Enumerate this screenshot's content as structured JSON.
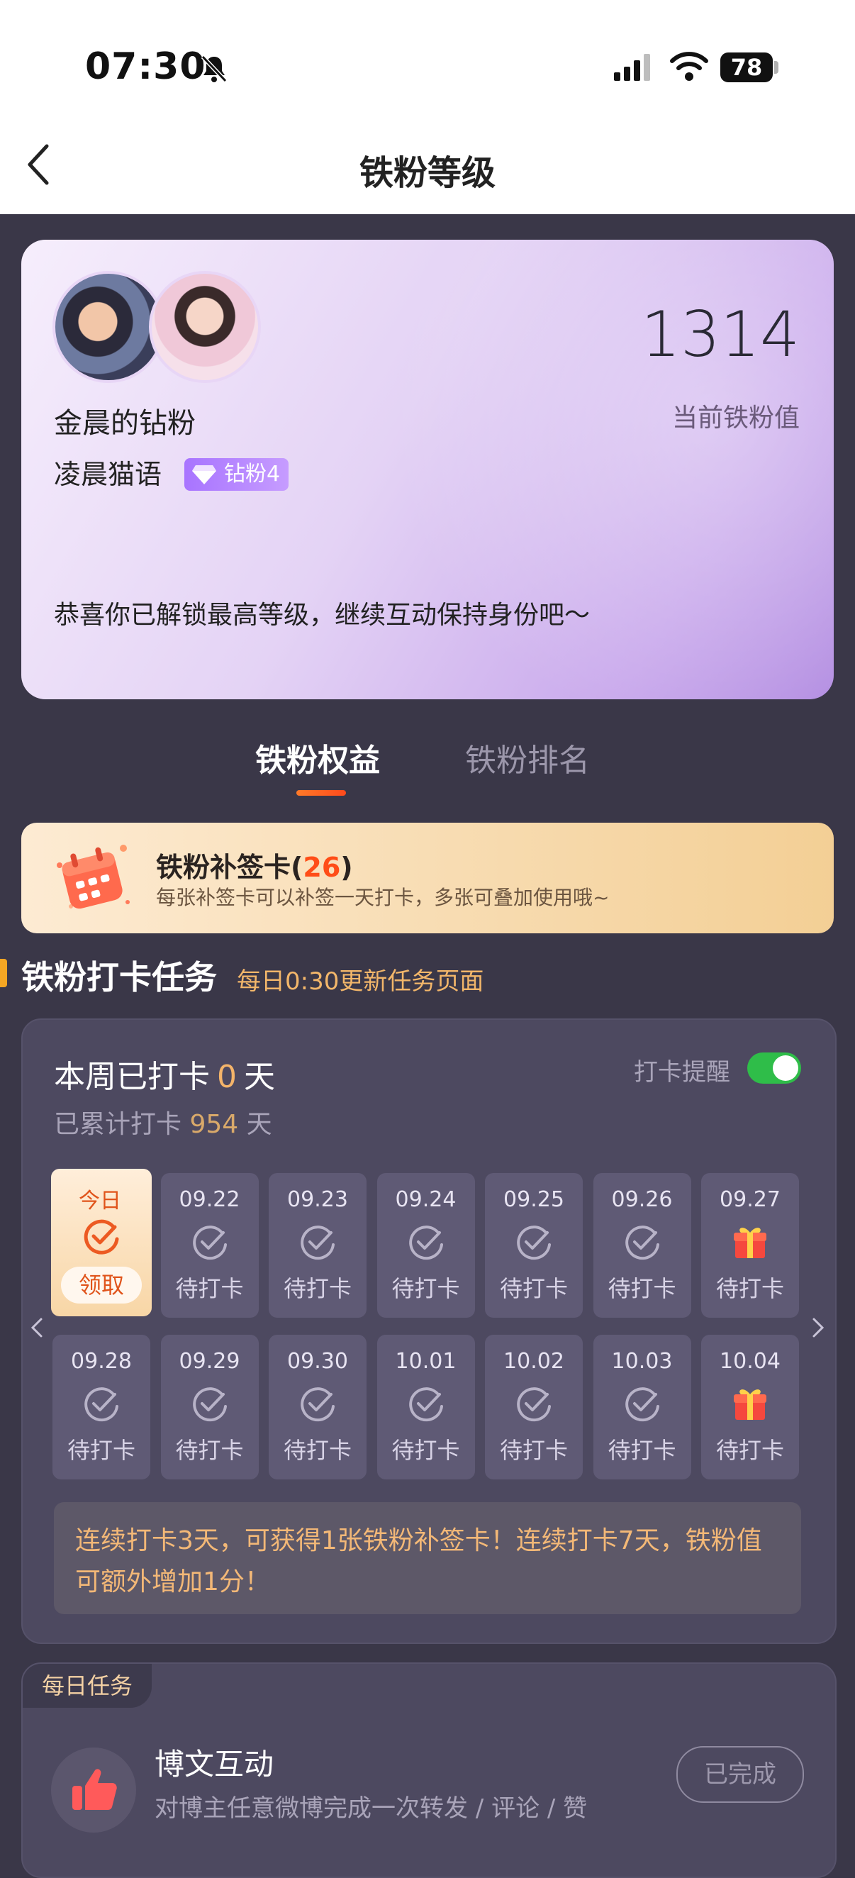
{
  "status": {
    "time": "07:30",
    "battery": "78"
  },
  "header": {
    "title": "铁粉等级"
  },
  "profile": {
    "name": "金晨的钻粉",
    "username": "凌晨猫语",
    "badge": "钻粉4",
    "fan_value": "1314",
    "fan_value_label": "当前铁粉值",
    "message": "恭喜你已解锁最高等级，继续互动保持身份吧～"
  },
  "tabs": [
    {
      "label": "铁粉权益",
      "active": true
    },
    {
      "label": "铁粉排名",
      "active": false
    }
  ],
  "banner": {
    "title_prefix": "铁粉补签卡(",
    "count": "26",
    "title_suffix": ")",
    "subtitle": "每张补签卡可以补签一天打卡，多张可叠加使用哦~"
  },
  "section": {
    "title": "铁粉打卡任务",
    "subtitle": "每日0:30更新任务页面"
  },
  "checkin": {
    "week_prefix": "本周已打卡",
    "week_count": "0",
    "week_suffix": "天",
    "total_prefix": "已累计打卡",
    "total_count": "954",
    "total_suffix": "天",
    "remind_label": "打卡提醒",
    "remind_on": true,
    "today": {
      "label": "今日",
      "button": "领取"
    },
    "row1": [
      {
        "date": "09.22",
        "status": "待打卡",
        "icon": "check-circle-icon"
      },
      {
        "date": "09.23",
        "status": "待打卡",
        "icon": "check-circle-icon"
      },
      {
        "date": "09.24",
        "status": "待打卡",
        "icon": "check-circle-icon"
      },
      {
        "date": "09.25",
        "status": "待打卡",
        "icon": "check-circle-icon"
      },
      {
        "date": "09.26",
        "status": "待打卡",
        "icon": "check-circle-icon"
      },
      {
        "date": "09.27",
        "status": "待打卡",
        "icon": "gift-icon"
      }
    ],
    "row2": [
      {
        "date": "09.28",
        "status": "待打卡",
        "icon": "check-circle-icon"
      },
      {
        "date": "09.29",
        "status": "待打卡",
        "icon": "check-circle-icon"
      },
      {
        "date": "09.30",
        "status": "待打卡",
        "icon": "check-circle-icon"
      },
      {
        "date": "10.01",
        "status": "待打卡",
        "icon": "check-circle-icon"
      },
      {
        "date": "10.02",
        "status": "待打卡",
        "icon": "check-circle-icon"
      },
      {
        "date": "10.03",
        "status": "待打卡",
        "icon": "check-circle-icon"
      },
      {
        "date": "10.04",
        "status": "待打卡",
        "icon": "gift-icon"
      }
    ],
    "tip": "连续打卡3天，可获得1张铁粉补签卡！连续打卡7天，铁粉值可额外增加1分！"
  },
  "daily_task": {
    "tag": "每日任务",
    "name": "博文互动",
    "description": "对博主任意微博完成一次转发 / 评论 / 赞",
    "button": "已完成"
  },
  "colors": {
    "accent": "#ff4d17",
    "bg": "#3a3748",
    "toggle": "#2fbd49"
  }
}
